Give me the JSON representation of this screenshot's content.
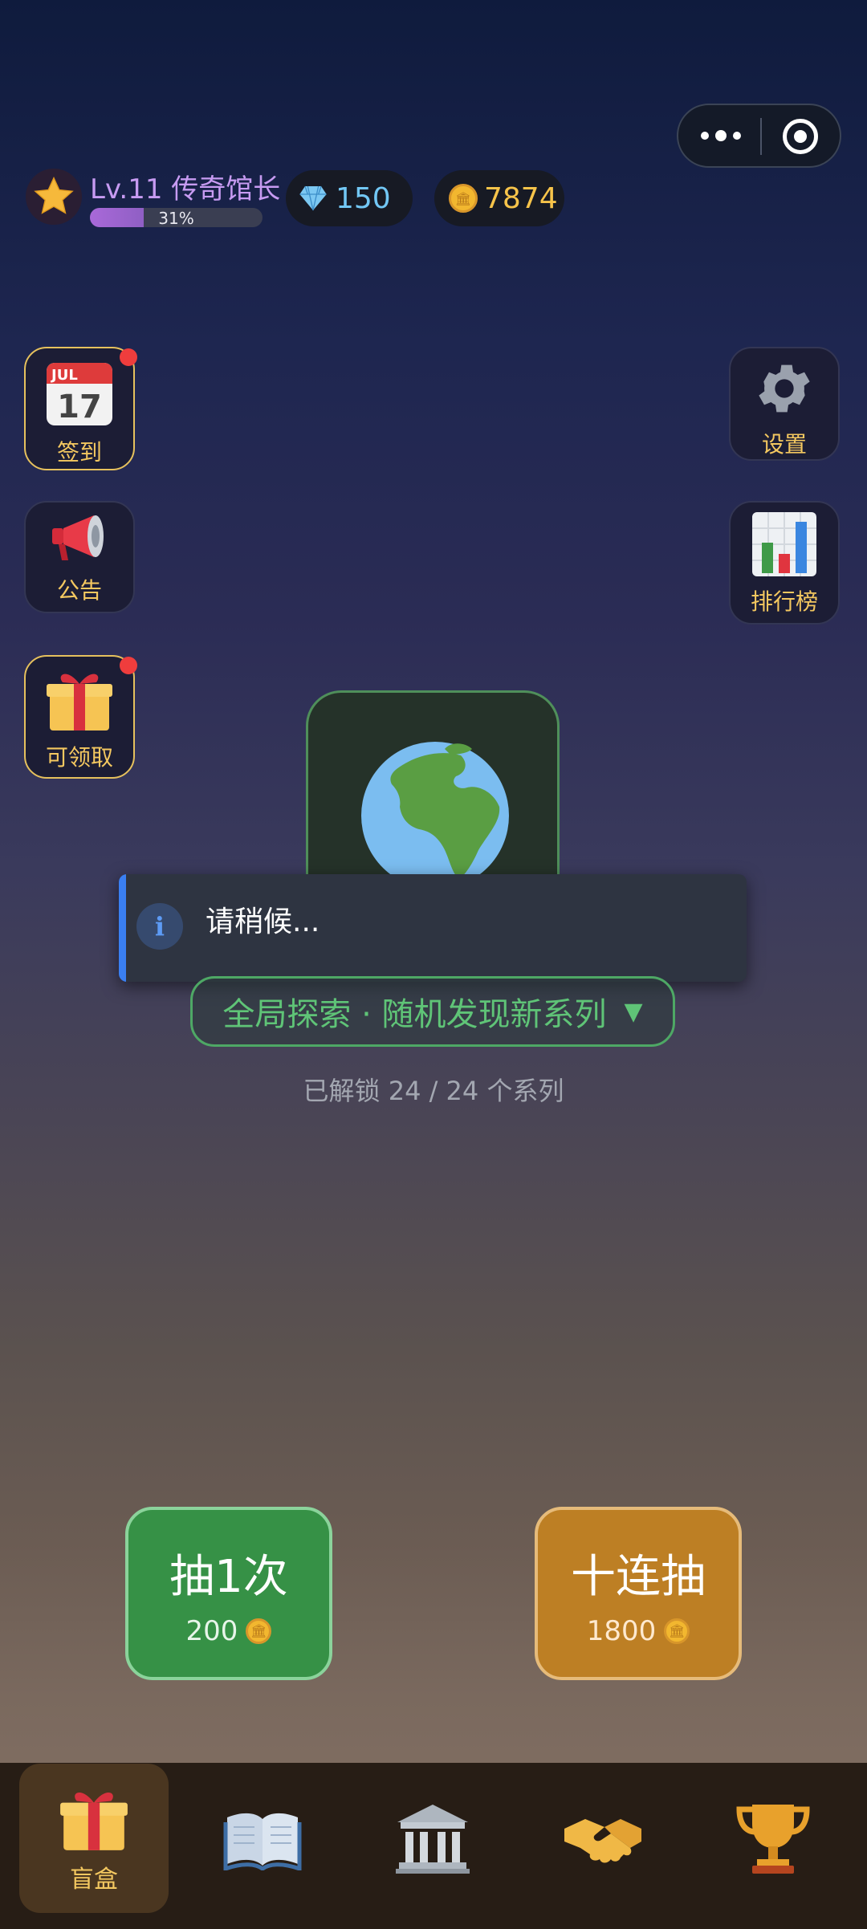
{
  "header": {
    "level": "Lv.11 传奇馆长",
    "xp_text": "31%",
    "xp_fraction": 0.31,
    "gems": "150",
    "coins": "7874"
  },
  "side_left": [
    {
      "label": "签到",
      "icon": "calendar-icon",
      "calendar_month": "JUL",
      "calendar_day": "17",
      "badge": true
    },
    {
      "label": "公告",
      "icon": "megaphone-icon",
      "badge": false
    },
    {
      "label": "可领取",
      "icon": "gift-icon",
      "badge": true
    }
  ],
  "side_right": [
    {
      "label": "设置",
      "icon": "gear-icon"
    },
    {
      "label": "排行榜",
      "icon": "bar-chart-icon"
    }
  ],
  "toast": {
    "message": "请稍候..."
  },
  "explore": {
    "label": "全局探索 · 随机发现新系列",
    "unlocked": "已解锁 24 / 24 个系列"
  },
  "draw": {
    "single": {
      "label": "抽1次",
      "cost": "200"
    },
    "ten": {
      "label": "十连抽",
      "cost": "1800"
    }
  },
  "nav": [
    {
      "label": "盲盒",
      "icon": "gift-icon",
      "active": true
    },
    {
      "label": "",
      "icon": "book-icon"
    },
    {
      "label": "",
      "icon": "museum-icon"
    },
    {
      "label": "",
      "icon": "handshake-icon"
    },
    {
      "label": "",
      "icon": "trophy-icon"
    }
  ],
  "colors": {
    "accent_green": "#369146",
    "accent_gold": "#bd7f24",
    "level_purple": "#c79bf2"
  }
}
